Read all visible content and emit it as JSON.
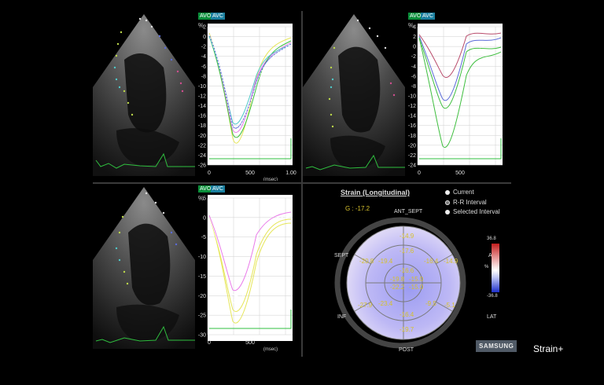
{
  "markers": {
    "avo": "AVO",
    "avc": "AVC"
  },
  "graphs": {
    "percent_symbol": "%",
    "top_left": {
      "y_ticks": [
        "2",
        "0",
        "-2",
        "-4",
        "-6",
        "-8",
        "-10",
        "-12",
        "-14",
        "-16",
        "-18",
        "-20",
        "-22",
        "-24",
        "-26"
      ],
      "x_ticks": [
        "0",
        "500",
        "1.00"
      ],
      "x_unit": "(msec)"
    },
    "top_right": {
      "y_ticks": [
        "4",
        "2",
        "0",
        "-2",
        "-4",
        "-6",
        "-8",
        "-10",
        "-12",
        "-14",
        "-16",
        "-18",
        "-20",
        "-22",
        "-24"
      ],
      "x_ticks": [
        "0",
        "500"
      ],
      "x_unit": ""
    },
    "bottom_left": {
      "y_ticks": [
        "5",
        "0",
        "-5",
        "-10",
        "-15",
        "-20",
        "-25",
        "-30"
      ],
      "x_ticks": [
        "0",
        "500"
      ],
      "x_unit": "(msec)"
    }
  },
  "bullseye": {
    "title": "Strain (Longitudinal)",
    "global": "G : -17.2",
    "walls": {
      "ant_sept": "ANT_SEPT",
      "sept": "SEPT",
      "ant": "ANT",
      "inf": "INF",
      "lat": "LAT",
      "post": "POST"
    },
    "segments": {
      "outer_top": "-14.9",
      "outer_left": "-20.8",
      "outer_right": "-14.9",
      "outer_bl": "-27.9",
      "outer_br": "-5.1",
      "outer_bottom": "-19.7",
      "mid_top": "-17.6",
      "mid_left": "-19.4",
      "mid_right": "-16.4",
      "mid_bl": "-23.4",
      "mid_br": "-9.5",
      "mid_bottom": "-16.4",
      "apex_top": "-16.6",
      "apex_left": "-19.8",
      "apex_right": "-15.0",
      "apex_bottom_left": "-22.2",
      "apex_bottom_right": "-15.0"
    },
    "colorbar": {
      "max": "36.8",
      "min": "-36.8",
      "unit": "%"
    }
  },
  "legend": {
    "current": "Current",
    "rr": "R-R Interval",
    "selected": "Selected Interval"
  },
  "brand": "SAMSUNG",
  "product": "Strain+"
}
